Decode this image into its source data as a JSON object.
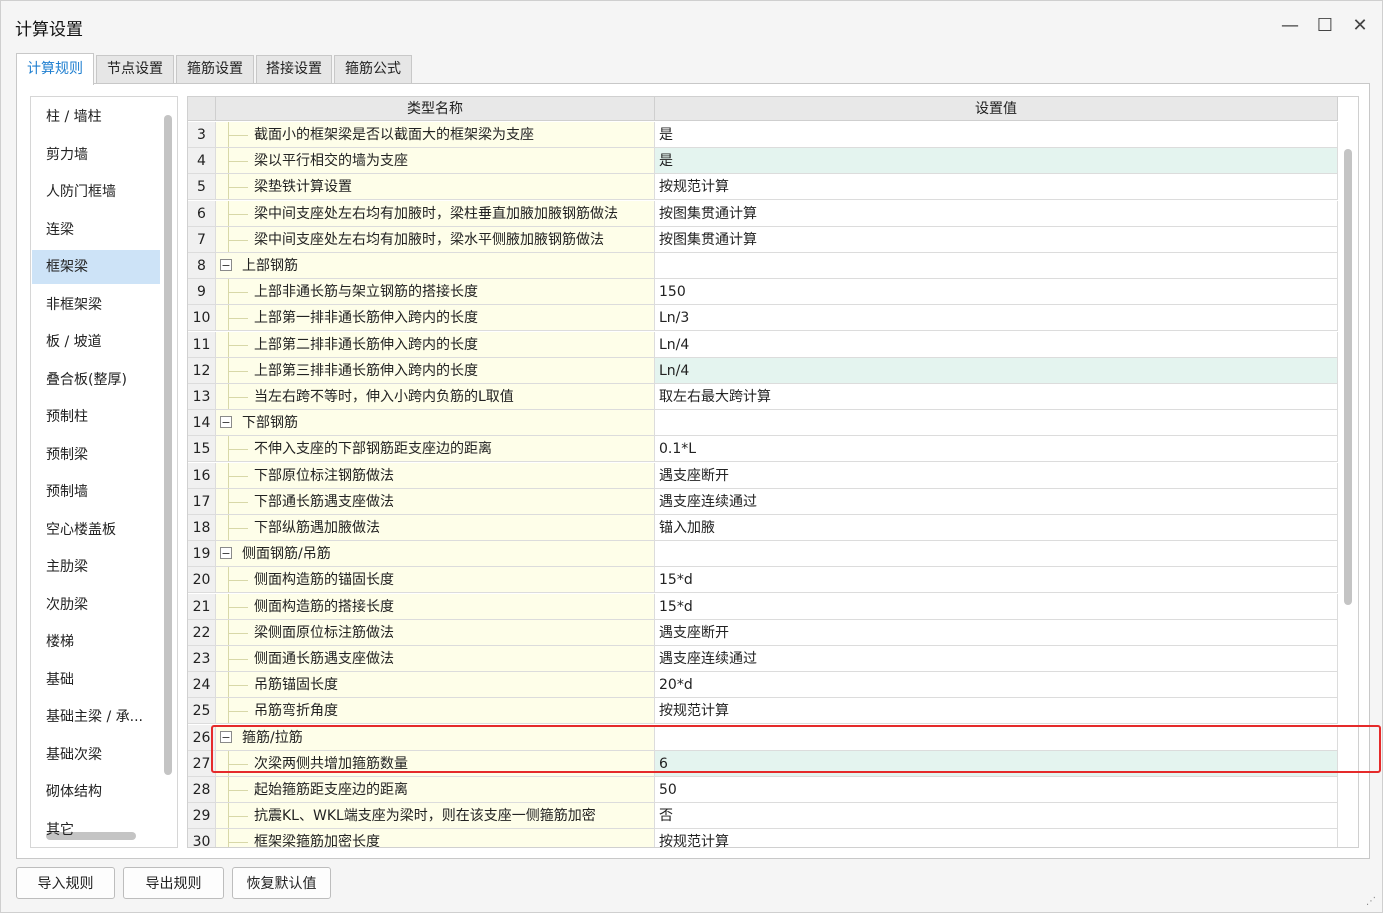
{
  "window": {
    "title": "计算设置"
  },
  "window_controls": {
    "minimize": "—",
    "maximize": "☐",
    "close": "✕"
  },
  "tabs": [
    {
      "label": "计算规则",
      "active": true
    },
    {
      "label": "节点设置"
    },
    {
      "label": "箍筋设置"
    },
    {
      "label": "搭接设置"
    },
    {
      "label": "箍筋公式"
    }
  ],
  "sidebar": {
    "items": [
      "柱 / 墙柱",
      "剪力墙",
      "人防门框墙",
      "连梁",
      "框架梁",
      "非框架梁",
      "板 / 坡道",
      "叠合板(整厚)",
      "预制柱",
      "预制梁",
      "预制墙",
      "空心楼盖板",
      "主肋梁",
      "次肋梁",
      "楼梯",
      "基础",
      "基础主梁 / 承...",
      "基础次梁",
      "砌体结构",
      "其它"
    ],
    "selected": "框架梁"
  },
  "table": {
    "columns": [
      "类型名称",
      "设置值"
    ],
    "rows": [
      {
        "num": "3",
        "name": "截面小的框架梁是否以截面大的框架梁为支座",
        "value": "是"
      },
      {
        "num": "4",
        "name": "梁以平行相交的墙为支座",
        "value": "是",
        "hl": true
      },
      {
        "num": "5",
        "name": "梁垫铁计算设置",
        "value": "按规范计算"
      },
      {
        "num": "6",
        "name": "梁中间支座处左右均有加腋时，梁柱垂直加腋加腋钢筋做法",
        "value": "按图集贯通计算"
      },
      {
        "num": "7",
        "name": "梁中间支座处左右均有加腋时，梁水平侧腋加腋钢筋做法",
        "value": "按图集贯通计算"
      },
      {
        "num": "8",
        "name": "上部钢筋",
        "value": "",
        "group": true
      },
      {
        "num": "9",
        "name": "上部非通长筋与架立钢筋的搭接长度",
        "value": "150"
      },
      {
        "num": "10",
        "name": "上部第一排非通长筋伸入跨内的长度",
        "value": "Ln/3"
      },
      {
        "num": "11",
        "name": "上部第二排非通长筋伸入跨内的长度",
        "value": "Ln/4"
      },
      {
        "num": "12",
        "name": "上部第三排非通长筋伸入跨内的长度",
        "value": "Ln/4",
        "hl": true
      },
      {
        "num": "13",
        "name": "当左右跨不等时，伸入小跨内负筋的L取值",
        "value": "取左右最大跨计算"
      },
      {
        "num": "14",
        "name": "下部钢筋",
        "value": "",
        "group": true
      },
      {
        "num": "15",
        "name": "不伸入支座的下部钢筋距支座边的距离",
        "value": "0.1*L"
      },
      {
        "num": "16",
        "name": "下部原位标注钢筋做法",
        "value": "遇支座断开"
      },
      {
        "num": "17",
        "name": "下部通长筋遇支座做法",
        "value": "遇支座连续通过"
      },
      {
        "num": "18",
        "name": "下部纵筋遇加腋做法",
        "value": "锚入加腋"
      },
      {
        "num": "19",
        "name": "侧面钢筋/吊筋",
        "value": "",
        "group": true
      },
      {
        "num": "20",
        "name": "侧面构造筋的锚固长度",
        "value": "15*d"
      },
      {
        "num": "21",
        "name": "侧面构造筋的搭接长度",
        "value": "15*d"
      },
      {
        "num": "22",
        "name": "梁侧面原位标注筋做法",
        "value": "遇支座断开"
      },
      {
        "num": "23",
        "name": "侧面通长筋遇支座做法",
        "value": "遇支座连续通过"
      },
      {
        "num": "24",
        "name": "吊筋锚固长度",
        "value": "20*d"
      },
      {
        "num": "25",
        "name": "吊筋弯折角度",
        "value": "按规范计算"
      },
      {
        "num": "26",
        "name": "箍筋/拉筋",
        "value": "",
        "group": true
      },
      {
        "num": "27",
        "name": "次梁两侧共增加箍筋数量",
        "value": "6",
        "hl": true
      },
      {
        "num": "28",
        "name": "起始箍筋距支座边的距离",
        "value": "50"
      },
      {
        "num": "29",
        "name": "抗震KL、WKL端支座为梁时，则在该支座一侧箍筋加密",
        "value": "否"
      },
      {
        "num": "30",
        "name": "框架梁箍筋加密长度",
        "value": "按规范计算"
      }
    ]
  },
  "buttons": {
    "import": "导入规则",
    "export": "导出规则",
    "restore": "恢复默认值"
  },
  "colors": {
    "accent": "#1f7fd0",
    "highlight_box": "#e52a2a",
    "row_highlight": "#e4f4ef",
    "name_cell": "#fefee9"
  }
}
